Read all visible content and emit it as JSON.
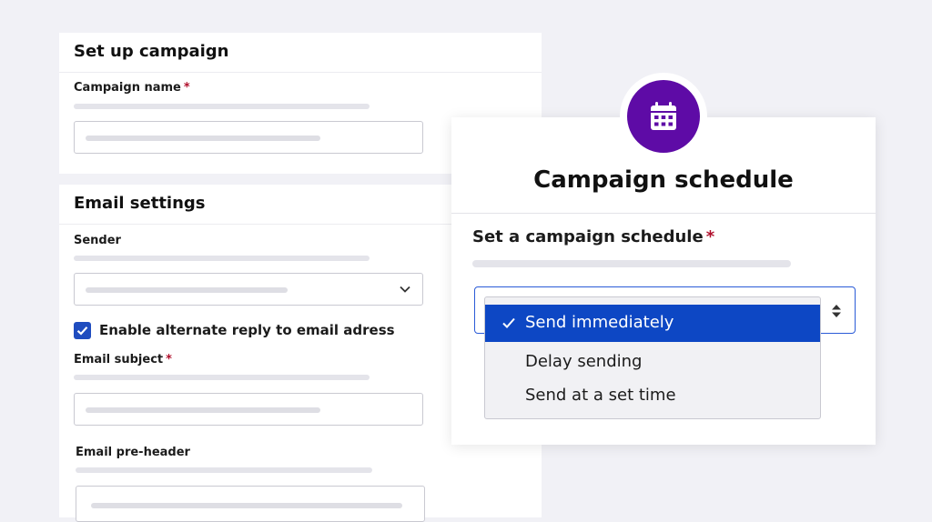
{
  "campaign_panel": {
    "title": "Set up campaign",
    "name_label": "Campaign name",
    "required_mark": "*"
  },
  "email_panel": {
    "title": "Email settings",
    "sender_label": "Sender",
    "alt_reply_label": "Enable alternate reply to email adress",
    "alt_reply_checked": true,
    "subject_label": "Email subject",
    "preheader_label": "Email pre-header"
  },
  "schedule_card": {
    "title": "Campaign schedule",
    "icon": "calendar-icon",
    "field_label": "Set a campaign schedule",
    "options": [
      {
        "label": "Send immediately",
        "selected": true
      },
      {
        "label": "Delay sending",
        "selected": false
      },
      {
        "label": "Send at a set time",
        "selected": false
      }
    ]
  },
  "colors": {
    "background": "#f1f1f6",
    "accent_purple": "#5e0ba6",
    "selected_blue": "#0d47c4",
    "required_red": "#b0102c"
  }
}
